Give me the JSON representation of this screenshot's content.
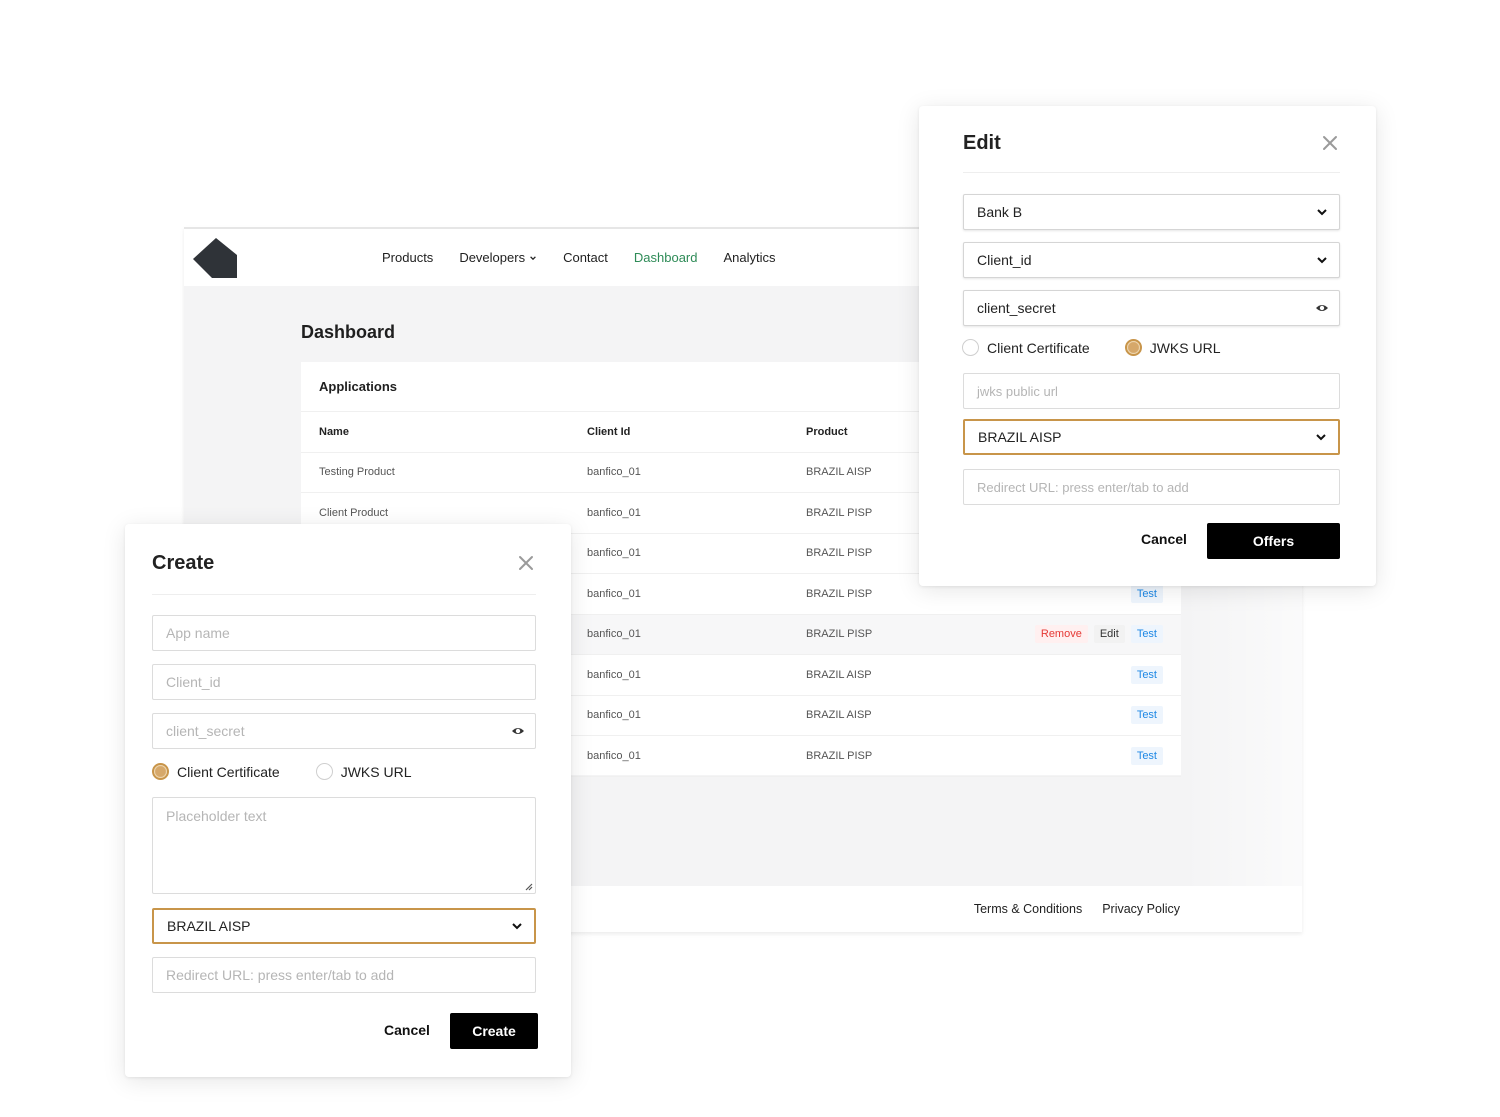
{
  "nav": {
    "links": [
      {
        "label": "Products"
      },
      {
        "label": "Developers"
      },
      {
        "label": "Contact"
      },
      {
        "label": "Dashboard"
      },
      {
        "label": "Analytics"
      }
    ],
    "active_color": "#2e8b57"
  },
  "dashboard": {
    "title": "Dashboard",
    "applications_heading": "Applications",
    "columns": {
      "name": "Name",
      "client_id": "Client Id",
      "product": "Product"
    },
    "rows": [
      {
        "name": "Testing Product",
        "client_id": "banfico_01",
        "product": "BRAZIL AISP"
      },
      {
        "name": "Client Product",
        "client_id": "banfico_01",
        "product": "BRAZIL PISP"
      },
      {
        "name": "",
        "client_id": "banfico_01",
        "product": "BRAZIL PISP"
      },
      {
        "name": "",
        "client_id": "banfico_01",
        "product": "BRAZIL PISP",
        "test": "Test"
      },
      {
        "name": "",
        "client_id": "banfico_01",
        "product": "BRAZIL PISP",
        "remove": "Remove",
        "edit": "Edit",
        "test": "Test"
      },
      {
        "name": "",
        "client_id": "banfico_01",
        "product": "BRAZIL AISP",
        "test": "Test"
      },
      {
        "name": "",
        "client_id": "banfico_01",
        "product": "BRAZIL AISP",
        "test": "Test"
      },
      {
        "name": "",
        "client_id": "banfico_01",
        "product": "BRAZIL PISP",
        "test": "Test"
      }
    ],
    "footer": {
      "terms": "Terms & Conditions",
      "privacy": "Privacy Policy"
    }
  },
  "edit_modal": {
    "title": "Edit",
    "bank_select": "Bank B",
    "client_id_select": "Client_id",
    "client_secret_value": "client_secret",
    "auth_options": {
      "client_certificate": "Client Certificate",
      "jwks_url": "JWKS URL",
      "selected": "jwks_url"
    },
    "jwks_placeholder": "jwks public url",
    "product_select": "BRAZIL AISP",
    "redirect_placeholder": "Redirect URL: press enter/tab to add",
    "cancel_label": "Cancel",
    "submit_label": "Offers"
  },
  "create_modal": {
    "title": "Create",
    "app_name_placeholder": "App name",
    "client_id_placeholder": "Client_id",
    "client_secret_placeholder": "client_secret",
    "auth_options": {
      "client_certificate": "Client Certificate",
      "jwks_url": "JWKS URL",
      "selected": "client_certificate"
    },
    "certificate_placeholder": "Placeholder text",
    "product_select": "BRAZIL AISP",
    "redirect_placeholder": "Redirect URL: press enter/tab to add",
    "cancel_label": "Cancel",
    "submit_label": "Create"
  },
  "colors": {
    "accent": "#c8954a",
    "primary_button": "#000000",
    "remove": "#e53935",
    "test": "#1e88e5"
  },
  "icons": {
    "logo": "pentagon-logo",
    "close": "close-icon",
    "chevron": "chevron-down-icon",
    "eye": "eye-icon"
  }
}
